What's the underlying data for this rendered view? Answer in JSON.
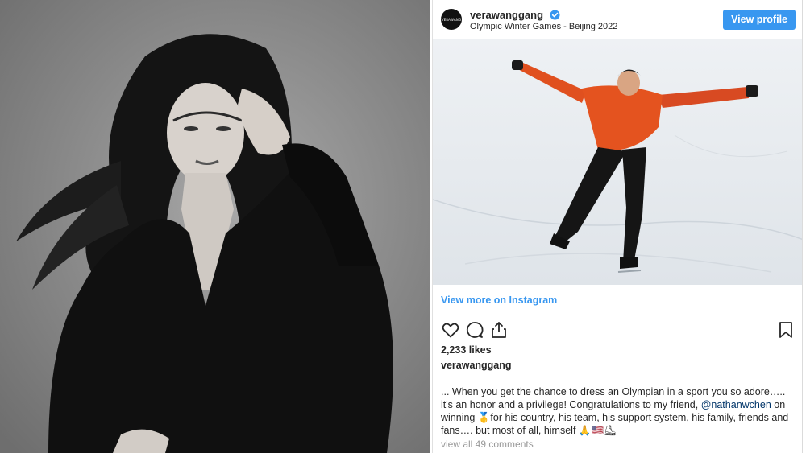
{
  "portrait": {
    "subject_icon": "portrait-photo"
  },
  "embed": {
    "avatar_text": "VERAWANG",
    "username": "verawanggang",
    "verified_icon": "verified-badge-icon",
    "location": "Olympic Winter Games - Beijing 2022",
    "view_profile_label": "View profile",
    "view_more_label": "View more on Instagram",
    "likes": "2,233 likes",
    "caption_user": "verawanggang",
    "caption_part1": "... When you get the chance to dress an Olympian in a sport you so adore….. it's an honor and a privilege! Congratulations to my friend, ",
    "caption_mention": "@nathanwchen",
    "caption_part2": " on winning 🥇for his country, his team, his support system, his family, friends and fans…. but most of all, himself 🙏🇺🇸⛸",
    "comments_link": "view all 49 comments",
    "icons": [
      "heart-icon",
      "comment-icon",
      "share-icon",
      "bookmark-icon"
    ],
    "colors": {
      "accent": "#3897f0",
      "text": "#262626",
      "muted": "#999999",
      "mention": "#003569"
    }
  }
}
